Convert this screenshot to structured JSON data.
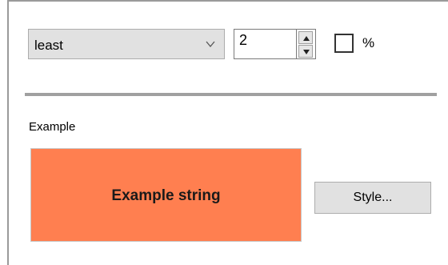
{
  "format": {
    "dropdown_value": "least",
    "dropdown_chevron_icon": "chevron-down-icon",
    "spin_value": "2",
    "spin_up_icon": "arrow-up-icon",
    "spin_down_icon": "arrow-down-icon",
    "percent_checked": false,
    "percent_label": "%"
  },
  "example": {
    "label": "Example",
    "preview_text": "Example string",
    "preview_background": "#ff7f50",
    "style_button_label": "Style..."
  }
}
